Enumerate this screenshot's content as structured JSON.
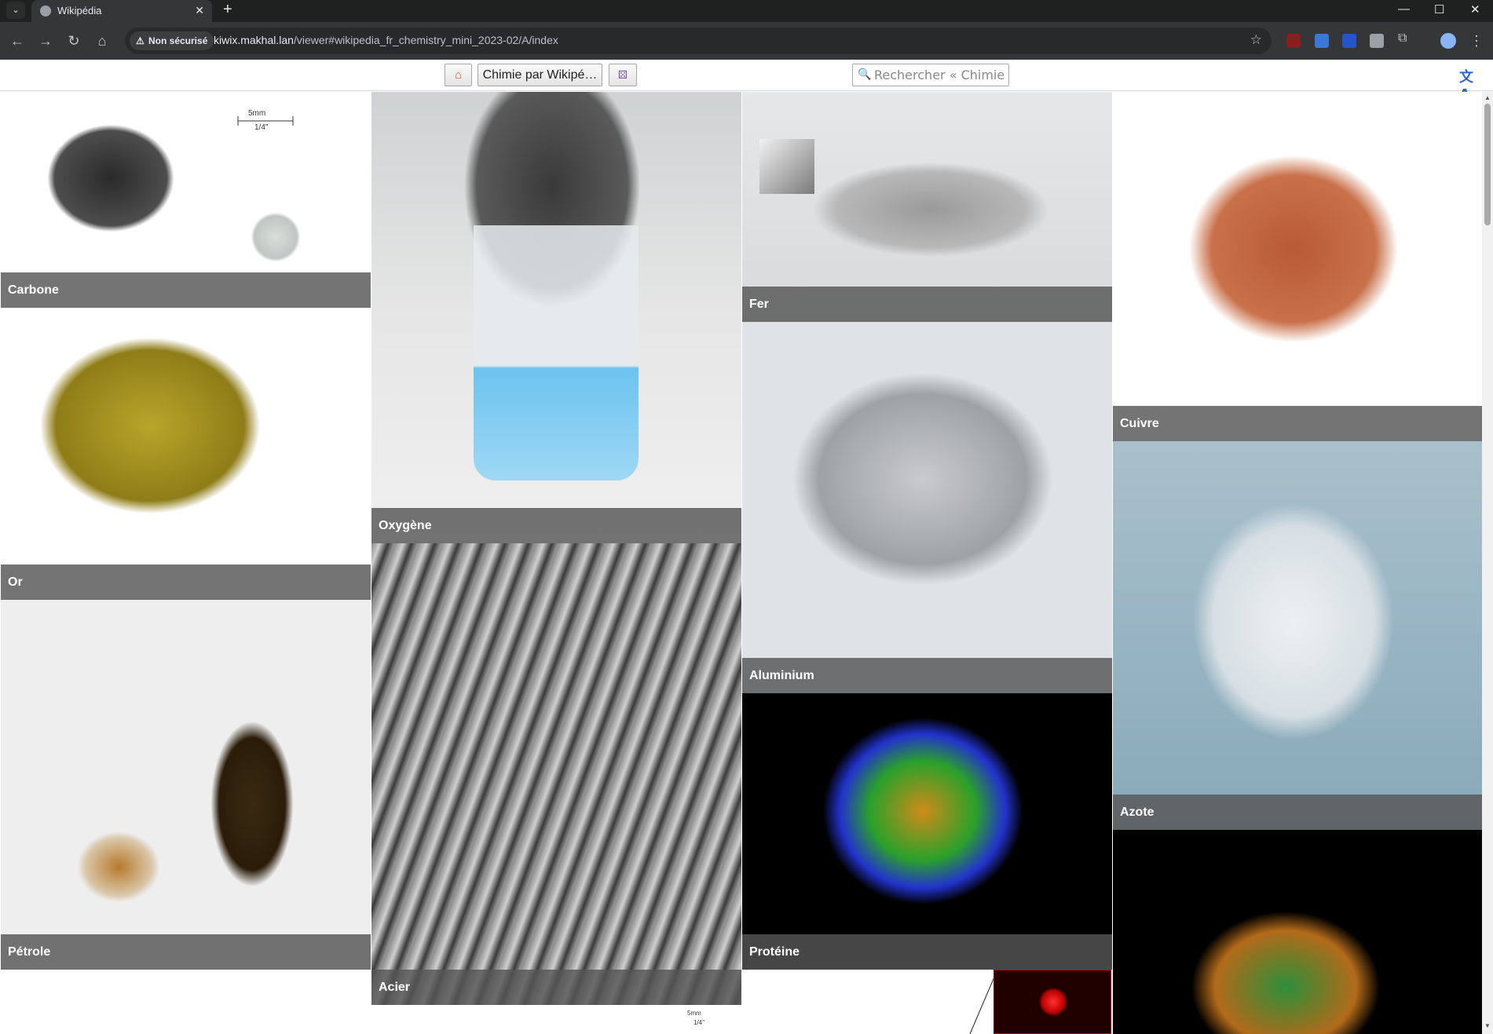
{
  "browser": {
    "tab_title": "Wikipédia",
    "new_tab_label": "+",
    "tab_close_label": "✕",
    "security_label": "Non sécurisé",
    "url_host": "kiwix.makhal.lan",
    "url_path": "/viewer#wikipedia_fr_chemistry_mini_2023-02/A/index"
  },
  "kiwix": {
    "library_title": "Chimie par Wikipé…",
    "search_placeholder": "Rechercher « Chimie pa"
  },
  "cards": {
    "carbone": "Carbone",
    "oxygene": "Oxygène",
    "fer": "Fer",
    "cuivre": "Cuivre",
    "or": "Or",
    "aluminium": "Aluminium",
    "azote": "Azote",
    "petrole": "Pétrole",
    "acier": "Acier",
    "proteine": "Protéine"
  },
  "image_marks": {
    "carbone_scale_top": "5mm",
    "carbone_scale_bottom": "1/4\"",
    "scale2_top": "5mm",
    "scale2_bottom": "1/4\""
  }
}
